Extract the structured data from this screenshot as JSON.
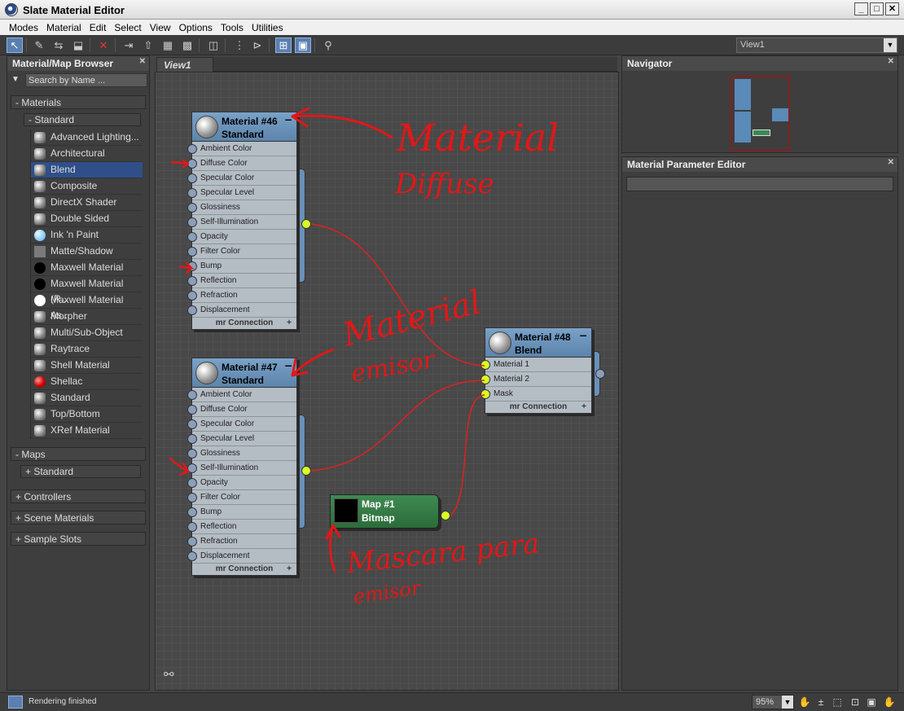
{
  "window": {
    "title": "Slate Material Editor"
  },
  "menu": [
    "Modes",
    "Material",
    "Edit",
    "Select",
    "View",
    "Options",
    "Tools",
    "Utilities"
  ],
  "toolbar": {
    "view_selector": "View1"
  },
  "browser": {
    "title": "Material/Map Browser",
    "search_placeholder": "Search by Name ...",
    "groups": {
      "materials": "- Materials",
      "standard_sub": "- Standard",
      "maps": "- Maps",
      "maps_standard": "+ Standard",
      "controllers": "+ Controllers",
      "scene_materials": "+ Scene Materials",
      "sample_slots": "+ Sample Slots"
    },
    "materials": [
      {
        "label": "Advanced Lighting...",
        "swatch": "sphere"
      },
      {
        "label": "Architectural",
        "swatch": "sphere"
      },
      {
        "label": "Blend",
        "swatch": "sphere",
        "selected": true
      },
      {
        "label": "Composite",
        "swatch": "sphere"
      },
      {
        "label": "DirectX Shader",
        "swatch": "sphere"
      },
      {
        "label": "Double Sided",
        "swatch": "sphere"
      },
      {
        "label": "Ink 'n Paint",
        "swatch": "blue"
      },
      {
        "label": "Matte/Shadow",
        "swatch": "gray"
      },
      {
        "label": "Maxwell Material",
        "swatch": "black"
      },
      {
        "label": "Maxwell Material (R...",
        "swatch": "black"
      },
      {
        "label": "Maxwell Material As...",
        "swatch": "white"
      },
      {
        "label": "Morpher",
        "swatch": "sphere"
      },
      {
        "label": "Multi/Sub-Object",
        "swatch": "sphere"
      },
      {
        "label": "Raytrace",
        "swatch": "sphere"
      },
      {
        "label": "Shell Material",
        "swatch": "sphere"
      },
      {
        "label": "Shellac",
        "swatch": "red"
      },
      {
        "label": "Standard",
        "swatch": "sphere"
      },
      {
        "label": "Top/Bottom",
        "swatch": "sphere"
      },
      {
        "label": "XRef Material",
        "swatch": "sphere"
      }
    ]
  },
  "view": {
    "tab": "View1",
    "node46": {
      "title": "Material #46",
      "type": "Standard",
      "slots": [
        "Ambient Color",
        "Diffuse Color",
        "Specular Color",
        "Specular Level",
        "Glossiness",
        "Self-Illumination",
        "Opacity",
        "Filter Color",
        "Bump",
        "Reflection",
        "Refraction",
        "Displacement"
      ],
      "footer": "mr Connection"
    },
    "node47": {
      "title": "Material #47",
      "type": "Standard",
      "slots": [
        "Ambient Color",
        "Diffuse Color",
        "Specular Color",
        "Specular Level",
        "Glossiness",
        "Self-Illumination",
        "Opacity",
        "Filter Color",
        "Bump",
        "Reflection",
        "Refraction",
        "Displacement"
      ],
      "footer": "mr Connection"
    },
    "node48": {
      "title": "Material #48",
      "type": "Blend",
      "slots": [
        "Material 1",
        "Material 2",
        "Mask"
      ],
      "footer": "mr Connection"
    },
    "map1": {
      "title": "Map #1",
      "type": "Bitmap"
    },
    "annotations": {
      "a1_line1": "Material",
      "a1_line2": "Diffuse",
      "a2_line1": "Material",
      "a2_line2": "emisor",
      "a3_line1": "Mascara para",
      "a3_line2": "emisor"
    },
    "wire_color": "#e02020",
    "annotation_color": "#e01818"
  },
  "navigator": {
    "title": "Navigator"
  },
  "param_editor": {
    "title": "Material Parameter Editor"
  },
  "status": {
    "text": "Rendering finished",
    "zoom": "95%"
  }
}
